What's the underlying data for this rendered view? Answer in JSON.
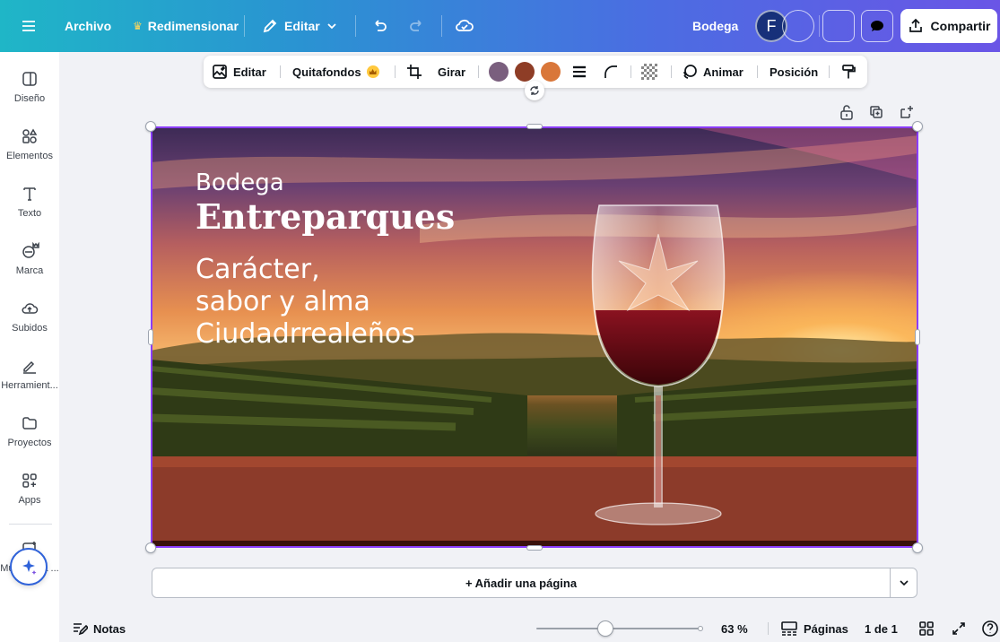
{
  "topbar": {
    "archivo": "Archivo",
    "redimensionar": "Redimensionar",
    "editar": "Editar",
    "project_title": "Bodega",
    "avatar_initial": "F",
    "share_label": "Compartir"
  },
  "sidebar": {
    "items": [
      {
        "label": "Diseño",
        "icon": "layout-icon"
      },
      {
        "label": "Elementos",
        "icon": "shapes-icon"
      },
      {
        "label": "Texto",
        "icon": "text-icon"
      },
      {
        "label": "Marca",
        "icon": "brand-icon"
      },
      {
        "label": "Subidos",
        "icon": "upload-cloud-icon"
      },
      {
        "label": "Herramient...",
        "icon": "tools-icon"
      },
      {
        "label": "Proyectos",
        "icon": "folder-icon"
      },
      {
        "label": "Apps",
        "icon": "apps-icon"
      },
      {
        "label": "Multimedia ...",
        "icon": "media-icon"
      }
    ]
  },
  "toolbar": {
    "edit": "Editar",
    "bg_remover": "Quitafondos",
    "rotate": "Girar",
    "colors": [
      "#7a5f7e",
      "#8e3d26",
      "#d9773a"
    ],
    "animate": "Animar",
    "position": "Posición"
  },
  "canvas": {
    "line1": "Bodega",
    "line2": "Entreparques",
    "tagline": [
      "Carácter,",
      "sabor y alma",
      "Ciudadrrealeños"
    ]
  },
  "add_page": "+ Añadir una página",
  "bottombar": {
    "notes": "Notas",
    "zoom": "63 %",
    "zoom_fraction": 0.42,
    "pages_label": "Páginas",
    "page_count": "1 de 1"
  }
}
